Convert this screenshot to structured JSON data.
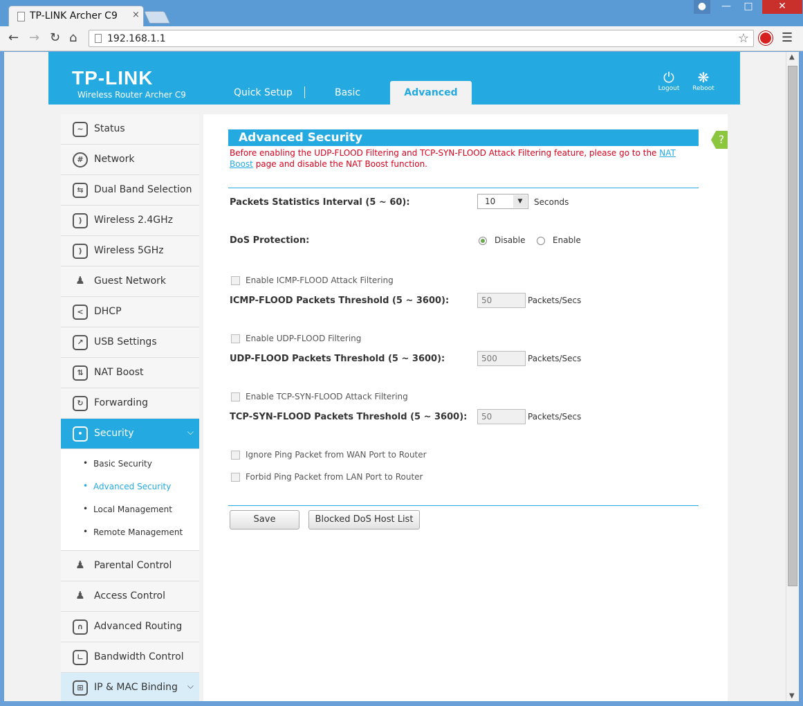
{
  "browser": {
    "tab_title": "TP-LINK Archer C9",
    "tab_close": "×",
    "url": "192.168.1.1",
    "icons": [
      "back-icon",
      "forward-icon",
      "reload-icon",
      "home-icon",
      "star-icon",
      "stop-icon",
      "menu-icon"
    ]
  },
  "header": {
    "logo": "TP-LINK",
    "model": "Wireless Router Archer C9",
    "tabs": [
      {
        "label": "Quick Setup"
      },
      {
        "label": "Basic"
      },
      {
        "label": "Advanced"
      }
    ],
    "logout_label": "Logout",
    "reboot_label": "Reboot",
    "accent_color": "#24a9e1"
  },
  "sidebar": {
    "items_top": [
      {
        "label": "Status",
        "icon": "status-icon"
      },
      {
        "label": "Network",
        "icon": "globe-icon"
      },
      {
        "label": "Dual Band Selection",
        "icon": "dual-band-icon"
      },
      {
        "label": "Wireless 2.4GHz",
        "icon": "wifi-icon"
      },
      {
        "label": "Wireless 5GHz",
        "icon": "wifi-icon"
      },
      {
        "label": "Guest Network",
        "icon": "guest-icon"
      },
      {
        "label": "DHCP",
        "icon": "dhcp-icon"
      },
      {
        "label": "USB Settings",
        "icon": "usb-icon"
      },
      {
        "label": "NAT Boost",
        "icon": "nat-icon"
      },
      {
        "label": "Forwarding",
        "icon": "forwarding-icon"
      }
    ],
    "active": {
      "label": "Security",
      "icon": "lock-icon"
    },
    "sub_items": [
      {
        "label": "Basic Security"
      },
      {
        "label": "Advanced Security"
      },
      {
        "label": "Local Management"
      },
      {
        "label": "Remote Management"
      }
    ],
    "items_bottom": [
      {
        "label": "Parental Control",
        "icon": "parental-icon"
      },
      {
        "label": "Access Control",
        "icon": "access-icon"
      },
      {
        "label": "Advanced Routing",
        "icon": "routing-icon"
      },
      {
        "label": "Bandwidth Control",
        "icon": "bandwidth-icon"
      },
      {
        "label": "IP & MAC Binding",
        "icon": "binding-icon"
      }
    ]
  },
  "main": {
    "title": "Advanced Security",
    "help": "?",
    "warning_pre": "Before enabling the UDP-FLOOD Filtering and TCP-SYN-FLOOD Attack Filtering feature, please go to the ",
    "warning_link": "NAT Boost",
    "warning_post": " page and disable the NAT Boost function.",
    "interval_label": "Packets Statistics Interval (5 ~ 60):",
    "interval_value": "10",
    "interval_unit": "Seconds",
    "dos_label": "DoS Protection:",
    "dos_disable": "Disable",
    "dos_enable": "Enable",
    "dos_selected": "Disable",
    "icmp_check": "Enable ICMP-FLOOD Attack Filtering",
    "icmp_label": "ICMP-FLOOD Packets Threshold (5 ~ 3600):",
    "icmp_value": "50",
    "udp_check": "Enable UDP-FLOOD Filtering",
    "udp_label": "UDP-FLOOD Packets Threshold (5 ~ 3600):",
    "udp_value": "500",
    "tcp_check": "Enable TCP-SYN-FLOOD Attack Filtering",
    "tcp_label": "TCP-SYN-FLOOD Packets Threshold (5 ~ 3600):",
    "tcp_value": "50",
    "unit": "Packets/Secs",
    "ignore_ping": "Ignore Ping Packet from WAN Port to Router",
    "forbid_ping": "Forbid Ping Packet from LAN Port to Router",
    "save_label": "Save",
    "blocked_label": "Blocked DoS Host List"
  }
}
